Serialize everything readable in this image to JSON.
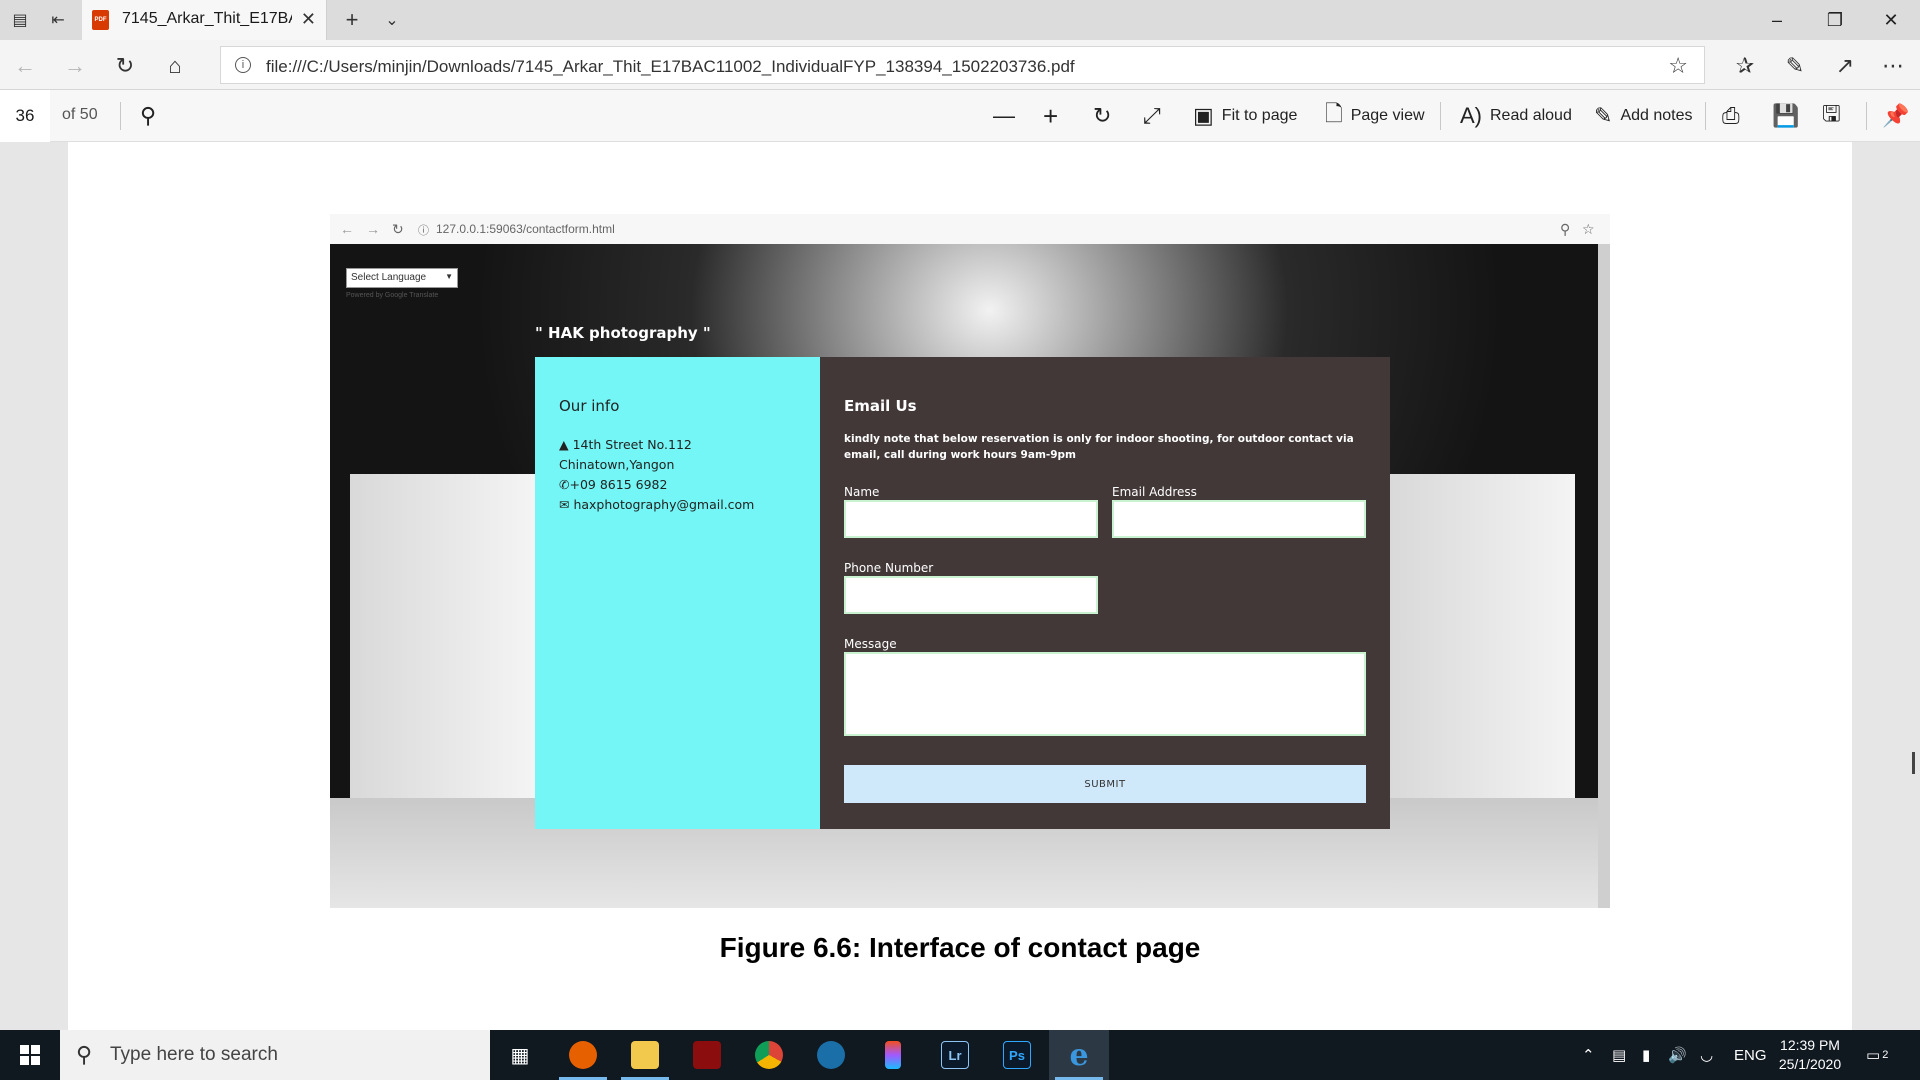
{
  "browser": {
    "tab_title": "7145_Arkar_Thit_E17BAC11002_IndividualFYP_138394_1502203736.pdf",
    "pdf_icon_text": "PDF",
    "url": "file:///C:/Users/minjin/Downloads/7145_Arkar_Thit_E17BAC11002_IndividualFYP_138394_1502203736.pdf"
  },
  "pdf_toolbar": {
    "page_number": "36",
    "page_total": "of 50",
    "fit_to_page": "Fit to page",
    "page_view": "Page view",
    "read_aloud": "Read aloud",
    "add_notes": "Add notes"
  },
  "embedded": {
    "url": "127.0.0.1:59063/contactform.html",
    "language_select": "Select Language",
    "powered_by": "Powered by Google Translate",
    "brand": "\" HAK photography \"",
    "info": {
      "heading": "Our info",
      "address1": "14th Street No.112",
      "address2": "Chinatown,Yangon",
      "phone": "+09 8615 6982",
      "email": "haxphotography@gmail.com"
    },
    "form": {
      "heading": "Email Us",
      "note": "kindly note that below reservation is only for indoor shooting, for outdoor contact via email, call during work hours 9am-9pm",
      "name_label": "Name",
      "email_label": "Email Address",
      "phone_label": "Phone Number",
      "message_label": "Message",
      "submit": "SUBMIT"
    }
  },
  "caption": "Figure 6.6: Interface of contact page",
  "taskbar": {
    "search_placeholder": "Type here to search",
    "language": "ENG",
    "time": "12:39 PM",
    "date": "25/1/2020",
    "notification_count": "2"
  }
}
